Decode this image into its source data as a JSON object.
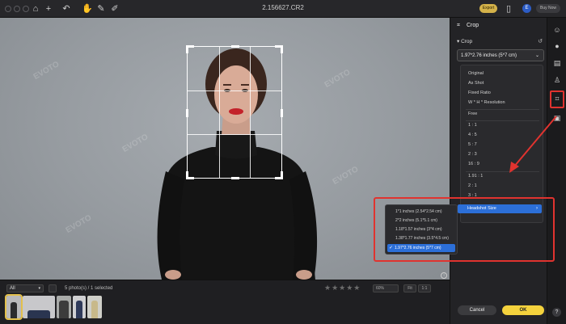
{
  "window": {
    "title": "2.156627.CR2",
    "export_label": "Export",
    "avatar_letter": "E",
    "buy_label": "Buy Now"
  },
  "panel": {
    "title": "Crop",
    "section_title": "Crop",
    "selected_size": "1.97*2.76 inches (5*7 cm)",
    "menu_items": [
      "Original",
      "As Shot",
      "Fixed Ratio",
      "W * H * Resolution",
      "Free",
      "1 : 1",
      "4 : 5",
      "5 : 7",
      "2 : 3",
      "16 : 9",
      "1.91 : 1",
      "2 : 1",
      "3 : 1"
    ],
    "highlighted_item": "Headshot Size",
    "cancel_label": "Cancel",
    "ok_label": "OK"
  },
  "submenu": {
    "items": [
      "1*1 inches (2.54*2.54 cm)",
      "2*2 inches (5.1*5.1 cm)",
      "1.18*1.57 inches (3*4 cm)",
      "1.38*1.77 inches (3.5*4.5 cm)",
      "1.97*2.76 inches (5*7 cm)"
    ],
    "selected_index": 4
  },
  "filmstrip": {
    "filter": "All",
    "count_text": "5 photo(s) / 1 selected",
    "zoom": "60%",
    "fit_label": "Fit",
    "one_to_one_label": "1:1",
    "rating_stars": "★★★★★"
  },
  "watermark_text": "EVOTO",
  "colors": {
    "accent_yellow": "#f4d23d",
    "selection_blue": "#2c6fd8",
    "annotation_red": "#e0332f"
  }
}
